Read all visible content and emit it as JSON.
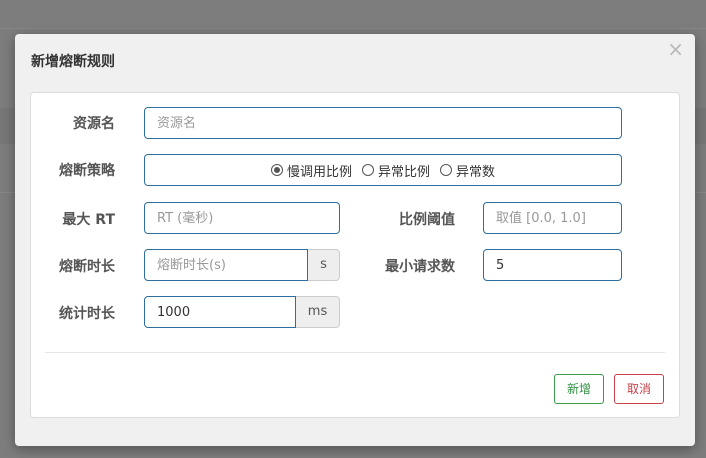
{
  "modal": {
    "title": "新增熔断规则",
    "close_icon": "×"
  },
  "form": {
    "resource": {
      "label": "资源名",
      "placeholder": "资源名",
      "value": ""
    },
    "strategy": {
      "label": "熔断策略",
      "options": [
        {
          "label": "慢调用比例",
          "checked": true
        },
        {
          "label": "异常比例",
          "checked": false
        },
        {
          "label": "异常数",
          "checked": false
        }
      ]
    },
    "max_rt": {
      "label": "最大 RT",
      "placeholder": "RT (毫秒)",
      "value": ""
    },
    "ratio_threshold": {
      "label": "比例阈值",
      "placeholder": "取值 [0.0, 1.0]",
      "value": ""
    },
    "break_duration": {
      "label": "熔断时长",
      "placeholder": "熔断时长(s)",
      "value": "",
      "unit": "s"
    },
    "min_request": {
      "label": "最小请求数",
      "value": "5"
    },
    "stat_duration": {
      "label": "统计时长",
      "value": "1000",
      "unit": "ms"
    }
  },
  "footer": {
    "add_label": "新增",
    "cancel_label": "取消"
  },
  "colors": {
    "input_border": "#2f6f9f",
    "add_button": "#3c9a4c",
    "cancel_button": "#c9404a"
  }
}
